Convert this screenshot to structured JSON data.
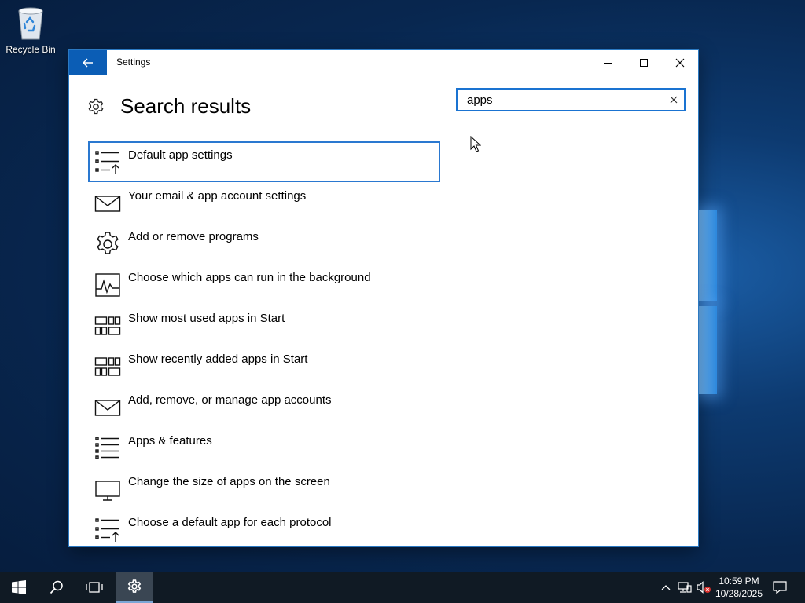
{
  "desktop": {
    "recycle_bin_label": "Recycle Bin"
  },
  "window": {
    "title": "Settings",
    "page_title": "Search results",
    "search": {
      "value": "apps"
    },
    "results": [
      {
        "label": "Default app settings",
        "icon": "list-arrow-icon",
        "selected": true
      },
      {
        "label": "Your email & app account settings",
        "icon": "mail-icon"
      },
      {
        "label": "Add or remove programs",
        "icon": "gear-icon"
      },
      {
        "label": "Choose which apps can run in the background",
        "icon": "activity-icon"
      },
      {
        "label": "Show most used apps in Start",
        "icon": "tiles-icon"
      },
      {
        "label": "Show recently added apps in Start",
        "icon": "tiles-icon"
      },
      {
        "label": "Add, remove, or manage app accounts",
        "icon": "mail-icon"
      },
      {
        "label": "Apps & features",
        "icon": "list-icon"
      },
      {
        "label": "Change the size of apps on the screen",
        "icon": "monitor-icon"
      },
      {
        "label": "Choose a default app for each protocol",
        "icon": "list-arrow-icon"
      }
    ]
  },
  "taskbar": {
    "time": "10:59 PM",
    "date": "10/28/2025"
  },
  "colors": {
    "accent": "#0b5db5",
    "selection_border": "#2a78d0",
    "taskbar": "#101a24"
  }
}
